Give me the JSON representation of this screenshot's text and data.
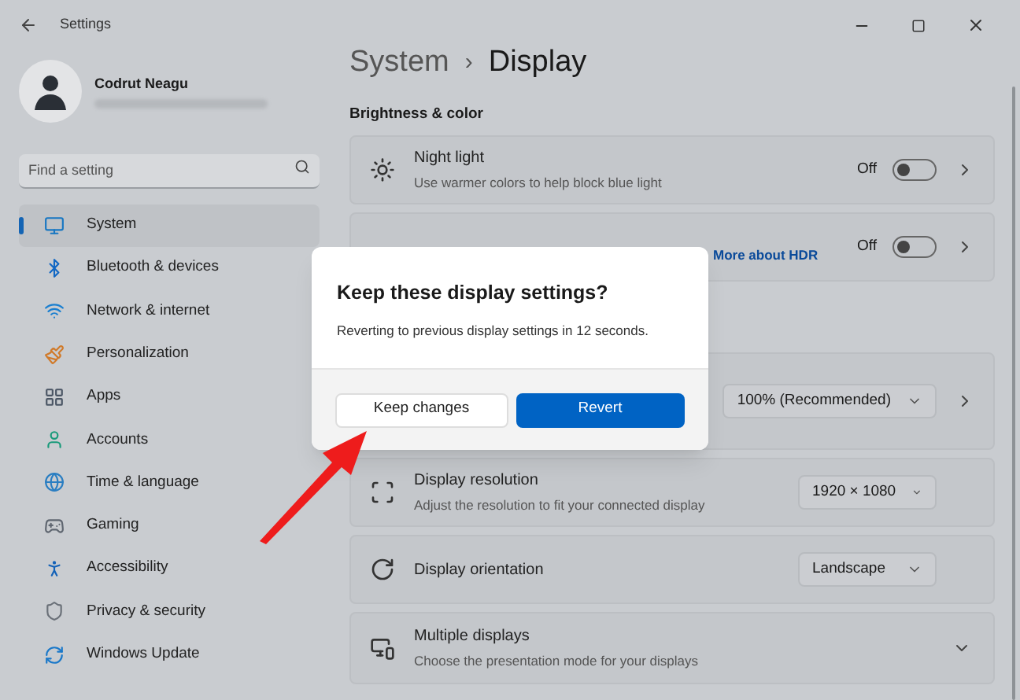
{
  "window": {
    "title": "Settings"
  },
  "user": {
    "name": "Codrut Neagu"
  },
  "search": {
    "placeholder": "Find a setting"
  },
  "sidebar": {
    "items": [
      {
        "label": "System",
        "selected": true
      },
      {
        "label": "Bluetooth & devices",
        "selected": false
      },
      {
        "label": "Network & internet",
        "selected": false
      },
      {
        "label": "Personalization",
        "selected": false
      },
      {
        "label": "Apps",
        "selected": false
      },
      {
        "label": "Accounts",
        "selected": false
      },
      {
        "label": "Time & language",
        "selected": false
      },
      {
        "label": "Gaming",
        "selected": false
      },
      {
        "label": "Accessibility",
        "selected": false
      },
      {
        "label": "Privacy & security",
        "selected": false
      },
      {
        "label": "Windows Update",
        "selected": false
      }
    ]
  },
  "breadcrumb": {
    "parent": "System",
    "separator": "›",
    "current": "Display"
  },
  "section": "Brightness & color",
  "cards": [
    {
      "kind": "toggle",
      "title": "Night light",
      "subtitle": "Use warmer colors to help block blue light",
      "state_label": "Off",
      "on": false
    },
    {
      "kind": "toggle",
      "link": "More about HDR",
      "state_label": "Off",
      "on": false
    },
    {
      "kind": "dropdown",
      "value": "100% (Recommended)"
    },
    {
      "kind": "dropdown",
      "title": "Display resolution",
      "subtitle": "Adjust the resolution to fit your connected display",
      "value": "1920 × 1080"
    },
    {
      "kind": "dropdown",
      "title": "Display orientation",
      "value": "Landscape"
    },
    {
      "kind": "expand",
      "title": "Multiple displays",
      "subtitle": "Choose the presentation mode for your displays"
    }
  ],
  "dialog": {
    "title": "Keep these display settings?",
    "message": "Reverting to previous display settings in 12 seconds.",
    "buttons": [
      "Keep changes",
      "Revert"
    ]
  }
}
